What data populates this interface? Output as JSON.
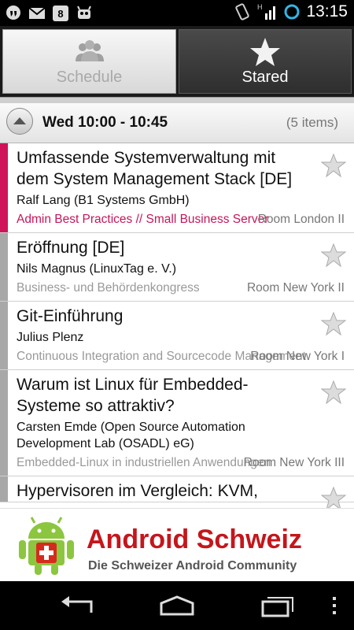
{
  "statusbar": {
    "time": "13:15",
    "left_icons": [
      "hangouts-icon",
      "gmail-icon",
      "app-icon",
      "android-icon"
    ],
    "right_icons": [
      "rotate-icon",
      "signal-h-icon",
      "sync-icon"
    ]
  },
  "tabs": [
    {
      "label": "Schedule",
      "icon": "people-icon",
      "selected": false
    },
    {
      "label": "Stared",
      "icon": "star-icon",
      "selected": true
    }
  ],
  "slot": {
    "time": "Wed 10:00 - 10:45",
    "count": "(5 items)"
  },
  "events": [
    {
      "title": "Umfassende Systemverwaltung mit dem System Management Stack [DE]",
      "speaker": "Ralf Lang (B1 Systems GmbH)",
      "track": "Admin Best Practices // Small Business Server",
      "room": "Room London II",
      "color": "#d0145a",
      "track_color": "#c4165a"
    },
    {
      "title": "Eröffnung [DE]",
      "speaker": "Nils Magnus (LinuxTag e. V.)",
      "track": "Business- und Behördenkongress",
      "room": "Room New York II",
      "color": "#a8a8a8",
      "track_color": "#999999"
    },
    {
      "title": "Git-Einführung",
      "speaker": "Julius Plenz",
      "track": "Continuous Integration and Sourcecode Management",
      "room": "Room New York I",
      "color": "#a8a8a8",
      "track_color": "#999999"
    },
    {
      "title": "Warum ist Linux für Embedded-Systeme so attraktiv?",
      "speaker": "Carsten Emde (Open Source Automation Development Lab (OSADL) eG)",
      "track": "Embedded-Linux in industriellen Anwendungen",
      "room": "Room New York III",
      "color": "#a8a8a8",
      "track_color": "#999999"
    },
    {
      "title": "Hypervisoren im Vergleich: KVM,",
      "speaker": "",
      "track": "",
      "room": "",
      "color": "#a8a8a8",
      "track_color": "#999999"
    }
  ],
  "ad": {
    "title": "Android Schweiz",
    "subtitle": "Die Schweizer Android Community"
  },
  "navbar": [
    "back-icon",
    "home-icon",
    "recent-apps-icon",
    "overflow-menu-icon"
  ],
  "colors": {
    "accent": "#c4161c",
    "magenta": "#d0145a"
  }
}
